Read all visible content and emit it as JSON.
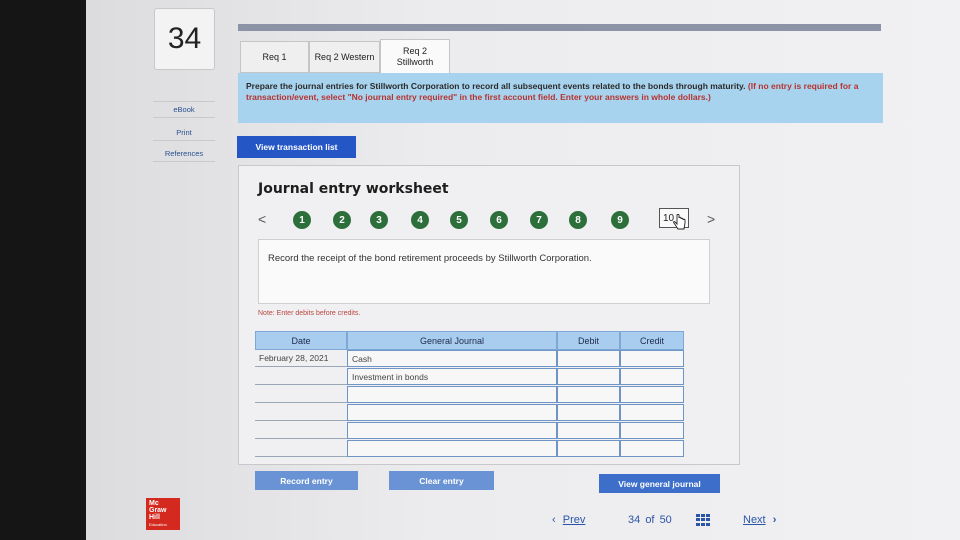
{
  "question_number": "34",
  "tabs": [
    {
      "label": "Req 1"
    },
    {
      "label": "Req 2 Western"
    },
    {
      "label": "Req 2 Stillworth"
    }
  ],
  "instructions": {
    "main": "Prepare the journal entries for Stillworth Corporation to record all subsequent events related to the bonds through maturity.",
    "red": "(If no entry is required for a transaction/event, select \"No journal entry required\" in the first account field. Enter your answers in whole dollars.)"
  },
  "sidebar": {
    "ebook": "eBook",
    "print": "Print",
    "references": "References"
  },
  "view_transaction_list": "View transaction list",
  "worksheet": {
    "title": "Journal entry worksheet",
    "prev_arrow": "<",
    "next_arrow": ">",
    "steps": [
      "1",
      "2",
      "3",
      "4",
      "5",
      "6",
      "7",
      "8",
      "9"
    ],
    "current_step": "10",
    "description": "Record the receipt of the bond retirement proceeds by Stillworth Corporation.",
    "note": "Note: Enter debits before credits."
  },
  "journal": {
    "headers": {
      "date": "Date",
      "general_journal": "General Journal",
      "debit": "Debit",
      "credit": "Credit"
    },
    "rows": [
      {
        "date": "February 28, 2021",
        "account": "Cash",
        "debit": "",
        "credit": ""
      },
      {
        "date": "",
        "account": "Investment in bonds",
        "debit": "",
        "credit": ""
      },
      {
        "date": "",
        "account": "",
        "debit": "",
        "credit": ""
      },
      {
        "date": "",
        "account": "",
        "debit": "",
        "credit": ""
      },
      {
        "date": "",
        "account": "",
        "debit": "",
        "credit": ""
      },
      {
        "date": "",
        "account": "",
        "debit": "",
        "credit": ""
      }
    ]
  },
  "buttons": {
    "record_entry": "Record entry",
    "clear_entry": "Clear entry",
    "view_general_journal": "View general journal"
  },
  "footer": {
    "logo_text": "Mc Graw Hill Education",
    "prev": "Prev",
    "page_current": "34",
    "page_of": "of",
    "page_total": "50",
    "next": "Next"
  }
}
